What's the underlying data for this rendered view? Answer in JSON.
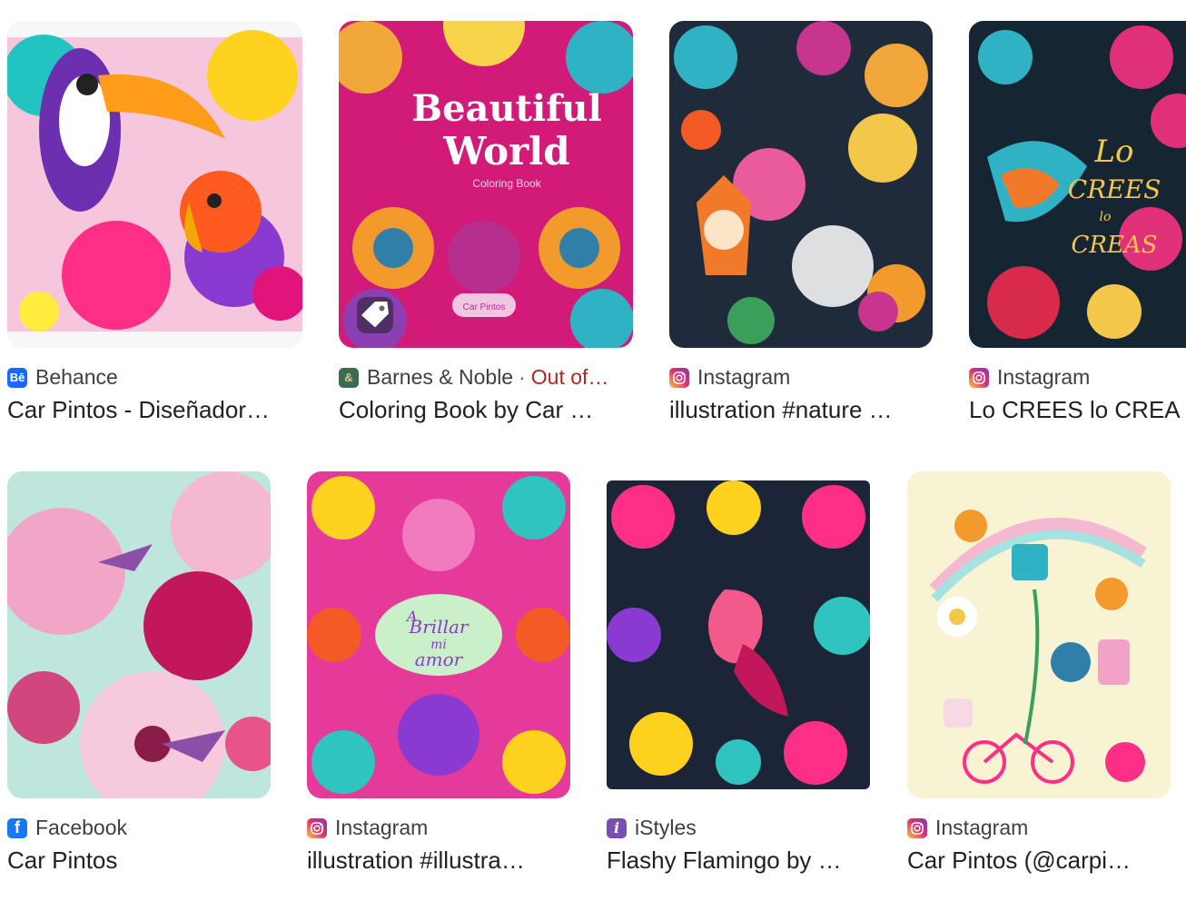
{
  "colors": {
    "behance": "#1769ff",
    "barnes": "#3d6b4f",
    "instagram": "#e1306c",
    "facebook": "#1877f2",
    "istyles": "#7b4fb2",
    "out_of_stock": "#b3261e"
  },
  "results": [
    {
      "source": "Behance",
      "favicon": "behance-icon",
      "favicon_text": "Bē",
      "title": "Car Pintos - Diseñador…"
    },
    {
      "source": "Barnes & Noble",
      "favicon": "barnes-noble-icon",
      "favicon_text": "&",
      "separator": "·",
      "status": "Out of…",
      "title": "Coloring Book by Car …",
      "overlay_title_1": "Beautiful",
      "overlay_title_2": "World",
      "overlay_subtitle": "Coloring Book",
      "overlay_brand": "Car Pintos"
    },
    {
      "source": "Instagram",
      "favicon": "instagram-icon",
      "title": "illustration #nature …"
    },
    {
      "source": "Instagram",
      "favicon": "instagram-icon",
      "title": "Lo CREES lo CREA",
      "overlay_1": "Lo",
      "overlay_2": "CREES",
      "overlay_3": "lo",
      "overlay_4": "CREAS"
    },
    {
      "source": "Facebook",
      "favicon": "facebook-icon",
      "favicon_text": "f",
      "title": "Car Pintos"
    },
    {
      "source": "Instagram",
      "favicon": "instagram-icon",
      "title": "illustration #illustra…",
      "overlay_1": "A",
      "overlay_2": "Brillar",
      "overlay_3": "mi",
      "overlay_4": "amor"
    },
    {
      "source": "iStyles",
      "favicon": "istyles-icon",
      "favicon_text": "i",
      "title": "Flashy Flamingo by …"
    },
    {
      "source": "Instagram",
      "favicon": "instagram-icon",
      "title": "Car Pintos (@carpi…"
    }
  ]
}
